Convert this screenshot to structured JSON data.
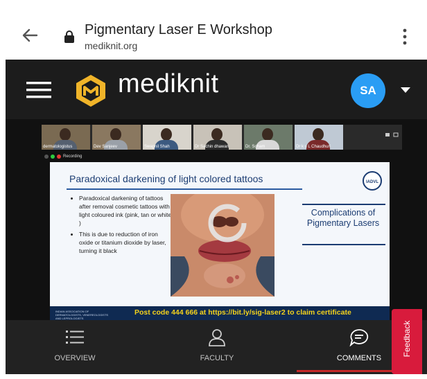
{
  "browser": {
    "title": "Pigmentary Laser E Workshop",
    "domain": "mediknit.org"
  },
  "header": {
    "logo_text": "mediknit",
    "avatar_initials": "SA",
    "colors": {
      "header_bg": "#1c1c1c",
      "avatar_bg": "#2a9df4",
      "logo_gold": "#f0b429"
    }
  },
  "video": {
    "participants": [
      {
        "name": "dermatologistus"
      },
      {
        "name": "Dev Sanjeev"
      },
      {
        "name": "Swapnil Shah"
      },
      {
        "name": "Dr Sachin dhawan"
      },
      {
        "name": "Dr. Soham"
      },
      {
        "name": "Dr k s L Chaudhuri"
      }
    ],
    "recording_label": "Recording"
  },
  "slide": {
    "title": "Paradoxical darkening of light colored tattoos",
    "logo_text": "IADVL",
    "bullets": [
      "Paradoxical darkening of tattoos after removal cosmetic tattoos with light coloured ink (pink, tan or white )",
      "This is due to reduction of iron oxide or titanium dioxide by laser, turning it black"
    ],
    "callout": "Complications of Pigmentary Lasers",
    "footer_small": "INDIAN ASSOCIATION OF DERMATOLOGISTS, VENEREOLOGISTS AND LEPROLOGISTS",
    "post_code": "Post code 444 666 at https://bit.ly/sig-laser2 to claim certificate"
  },
  "bottom_nav": {
    "tabs": [
      {
        "label": "OVERVIEW",
        "icon": "list-icon"
      },
      {
        "label": "FACULTY",
        "icon": "person-icon"
      },
      {
        "label": "COMMENTS",
        "icon": "chat-icon"
      }
    ],
    "active": "COMMENTS",
    "accent": "#c62828"
  },
  "feedback": {
    "label": "Feedback",
    "color": "#d81b3c"
  }
}
